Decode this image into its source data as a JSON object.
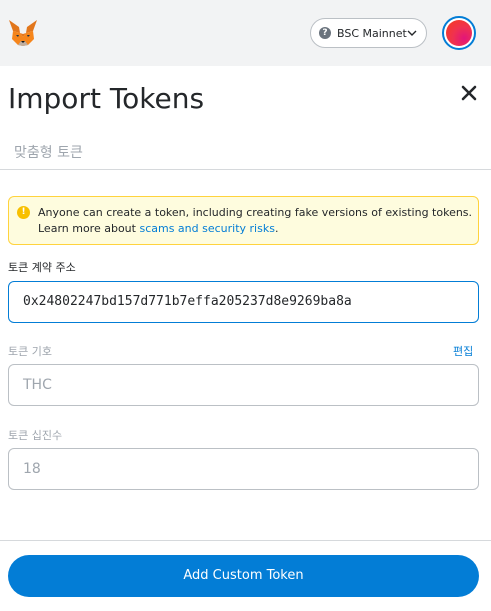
{
  "header": {
    "logo_icon": "metamask-fox-icon",
    "network": {
      "label": "BSC Mainnet",
      "icon": "help-circle-icon",
      "chevron": "chevron-down-icon"
    },
    "account_icon": "account-avatar"
  },
  "page": {
    "title": "Import Tokens",
    "close_icon": "close-icon"
  },
  "tabs": {
    "custom_token": "맞춤형 토큰"
  },
  "warning": {
    "icon": "info-icon",
    "text": "Anyone can create a token, including creating fake versions of existing tokens. Learn more about ",
    "link": "scams and security risks",
    "suffix": "."
  },
  "form": {
    "contract_address": {
      "label": "토큰 계약 주소",
      "value": "0x24802247bd157d771b7effa205237d8e9269ba8a"
    },
    "symbol": {
      "label": "토큰 기호",
      "edit_label": "편집",
      "value": "THC"
    },
    "decimals": {
      "label": "토큰 십진수",
      "value": "18"
    }
  },
  "footer": {
    "add_button": "Add Custom Token"
  },
  "colors": {
    "accent": "#037dd6",
    "header_bg": "#f2f3f4",
    "warning_bg": "#fefcde",
    "warning_border": "#ffd33d",
    "warning_icon": "#f8c000"
  }
}
